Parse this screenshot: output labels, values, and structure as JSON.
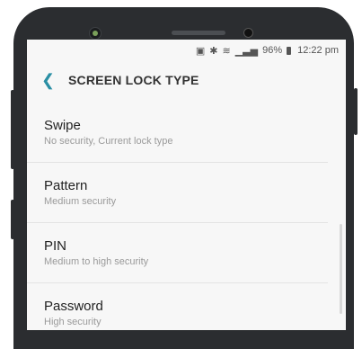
{
  "status_bar": {
    "icons": [
      "screenshot-icon",
      "bluetooth-icon",
      "wifi-icon",
      "signal-icon"
    ],
    "battery_percent": "96%",
    "battery_icon": "battery-icon",
    "time": "12:22 pm"
  },
  "header": {
    "back_icon": "back-arrow-icon",
    "title": "SCREEN LOCK TYPE"
  },
  "options": [
    {
      "title": "Swipe",
      "subtitle": "No security, Current lock type"
    },
    {
      "title": "Pattern",
      "subtitle": "Medium security"
    },
    {
      "title": "PIN",
      "subtitle": "Medium to high security"
    },
    {
      "title": "Password",
      "subtitle": "High security"
    }
  ],
  "colors": {
    "accent": "#2a8fa4",
    "background": "#f7f7f7",
    "phone_body": "#2b2d30"
  }
}
